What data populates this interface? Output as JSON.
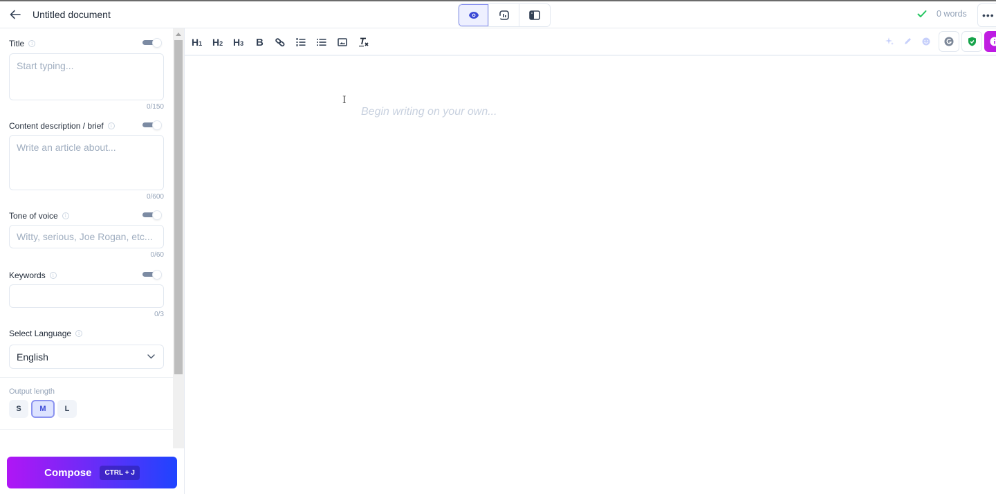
{
  "header": {
    "back_icon": "arrow-left-icon",
    "title": "Untitled document",
    "view_modes": [
      {
        "name": "preview",
        "icon": "eye-icon",
        "active": true
      },
      {
        "name": "analytics",
        "icon": "chart-bars-icon",
        "active": false
      },
      {
        "name": "sidebar-layout",
        "icon": "sidebar-panel-icon",
        "active": false
      }
    ],
    "status_icon": "check-icon",
    "word_count": "0 words",
    "more_icon": "more-horizontal-icon",
    "colors": {
      "check": "#22c55e",
      "active_view": "#3b49d6"
    }
  },
  "sidebar": {
    "title_field": {
      "label": "Title",
      "placeholder": "Start typing...",
      "value": "",
      "counter": "0/150",
      "enabled": true
    },
    "brief_field": {
      "label": "Content description / brief",
      "placeholder": "Write an article about...",
      "value": "",
      "counter": "0/600",
      "enabled": true
    },
    "tone_field": {
      "label": "Tone of voice",
      "placeholder": "Witty, serious, Joe Rogan, etc...",
      "value": "",
      "counter": "0/60",
      "enabled": true
    },
    "keywords_field": {
      "label": "Keywords",
      "placeholder": "",
      "value": "",
      "counter": "0/3",
      "enabled": true
    },
    "language": {
      "label": "Select Language",
      "selected": "English"
    },
    "output_length": {
      "label": "Output length",
      "options": [
        "S",
        "M",
        "L"
      ],
      "selected": "M"
    },
    "compose": {
      "label": "Compose",
      "shortcut": "CTRL + J",
      "gradient": [
        "#b016f5",
        "#1f44ff"
      ]
    }
  },
  "toolbar": {
    "items": [
      {
        "name": "heading-1",
        "label": "H",
        "sub": "1"
      },
      {
        "name": "heading-2",
        "label": "H",
        "sub": "2"
      },
      {
        "name": "heading-3",
        "label": "H",
        "sub": "3"
      },
      {
        "name": "bold",
        "label": "B"
      },
      {
        "name": "link",
        "icon": "link-icon"
      },
      {
        "name": "ordered-list",
        "icon": "ordered-list-icon"
      },
      {
        "name": "bullet-list",
        "icon": "bullet-list-icon"
      },
      {
        "name": "image",
        "icon": "image-icon"
      },
      {
        "name": "clear-format",
        "icon": "clear-format-icon"
      }
    ],
    "right_tools": [
      {
        "name": "ai-sparkle",
        "icon": "sparkle-icon"
      },
      {
        "name": "pen",
        "icon": "pen-icon"
      },
      {
        "name": "emoji",
        "icon": "smiley-icon"
      },
      {
        "name": "grammarly",
        "icon": "grammarly-icon"
      },
      {
        "name": "plagiarism-check",
        "icon": "shield-check-icon"
      },
      {
        "name": "info",
        "icon": "info-icon"
      }
    ]
  },
  "editor": {
    "placeholder": "Begin writing on your own...",
    "cursor": "I"
  }
}
